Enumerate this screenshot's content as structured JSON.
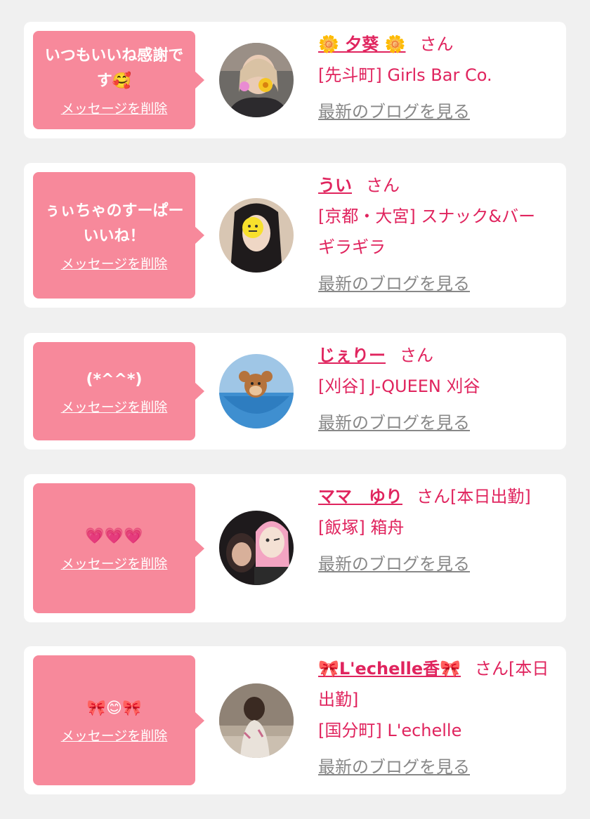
{
  "delete_label": "メッセージを削除",
  "blog_label": "最新のブログを見る",
  "honorific": "さん",
  "cards": [
    {
      "message": "いつもいいね感謝です🥰",
      "name": "🌼 夕葵 🌼",
      "after_name": "",
      "shop": "[先斗町] Girls Bar Co."
    },
    {
      "message": "ぅぃちゃのすーぱーいいね！",
      "name": "うい",
      "after_name": "",
      "shop": "[京都・大宮] スナック&バー ギラギラ"
    },
    {
      "message": "(*^^*)",
      "name": "じぇりー",
      "after_name": "",
      "shop": "[刈谷] J-QUEEN 刈谷"
    },
    {
      "message": "💗💗💗",
      "name": "ママ　ゆり",
      "after_name": "[本日出勤]",
      "shop": "[飯塚] 箱舟"
    },
    {
      "message": "🎀😊🎀",
      "name": "🎀L'echelle香🎀",
      "after_name": "[本日出勤]",
      "shop": "[国分町] L'echelle"
    }
  ],
  "colors": {
    "bubble": "#f7899b",
    "accent": "#e0245e",
    "link_gray": "#888888",
    "background": "#f0f0f0"
  }
}
